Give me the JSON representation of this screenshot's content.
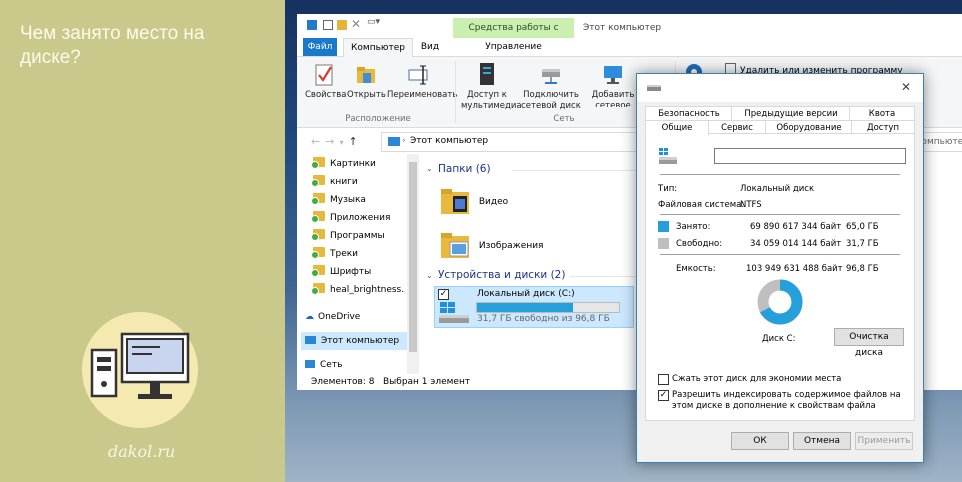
{
  "promo": {
    "title": "Чем занято место на диске?",
    "site": "dakol.ru"
  },
  "explorer": {
    "context_tab": "Средства работы с дисками",
    "window_title": "Этот компьютер",
    "tabs": {
      "file": "Файл",
      "computer": "Компьютер",
      "view": "Вид",
      "manage": "Управление"
    },
    "ribbon": {
      "properties": "Свойства",
      "open": "Открыть",
      "rename": "Переименовать",
      "group_location": "Расположение",
      "media_access": "Доступ к мультимедиа",
      "map_drive": "Подключить сетевой диск",
      "add_location": "Добавить сетевое расположение",
      "group_network": "Сеть",
      "uninstall": "Удалить или изменить программу"
    },
    "address": "Этот компьютер",
    "search_placeholder": "компьютер",
    "nav_items": [
      "Картинки",
      "книги",
      "Музыка",
      "Приложения",
      "Программы",
      "Треки",
      "Шрифты",
      "heal_brightness."
    ],
    "nav_onedrive": "OneDrive",
    "nav_this_pc": "Этот компьютер",
    "nav_network": "Сеть",
    "folders_header": "Папки (6)",
    "folders": [
      "Видео",
      "Изображения"
    ],
    "devices_header": "Устройства и диски (2)",
    "drive": {
      "name": "Локальный диск (C:)",
      "free_text": "31,7 ГБ свободно из 96,8 ГБ",
      "used_fraction": 0.673
    },
    "status": {
      "count": "Элементов: 8",
      "selected": "Выбран 1 элемент"
    }
  },
  "dialog": {
    "tabs_row1": [
      "Безопасность",
      "Предыдущие версии",
      "Квота"
    ],
    "tabs_row2": [
      "Общие",
      "Сервис",
      "Оборудование",
      "Доступ"
    ],
    "name_value": "",
    "type_label": "Тип:",
    "type_value": "Локальный диск",
    "fs_label": "Файловая система:",
    "fs_value": "NTFS",
    "used_label": "Занято:",
    "used_bytes": "69 890 617 344 байт",
    "used_gb": "65,0 ГБ",
    "free_label": "Свободно:",
    "free_bytes": "34 059 014 144 байт",
    "free_gb": "31,7 ГБ",
    "capacity_label": "Емкость:",
    "capacity_bytes": "103 949 631 488 байт",
    "capacity_gb": "96,8 ГБ",
    "disk_label": "Диск C:",
    "cleanup_button": "Очистка диска",
    "compress_label": "Сжать этот диск для экономии места",
    "index_label": "Разрешить индексировать содержимое файлов на этом диске в дополнение к свойствам файла",
    "ok": "ОК",
    "cancel": "Отмена",
    "apply": "Применить",
    "colors": {
      "used": "#26a0da",
      "free": "#bfbfbf"
    }
  }
}
